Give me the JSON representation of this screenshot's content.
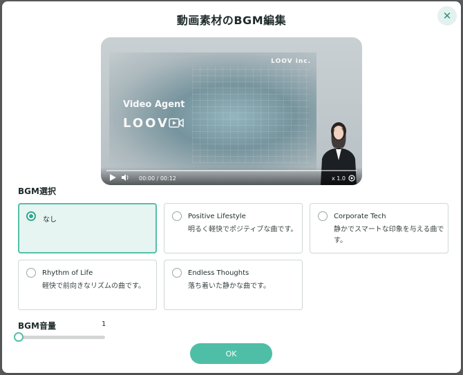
{
  "modal": {
    "title": "動画素材のBGM編集",
    "close_glyph": "✕"
  },
  "player": {
    "slide_brand": "LOOV inc.",
    "slide_heading": "Video Agent",
    "slide_logo": "LOOV",
    "time": "00:00 / 00:12",
    "speed": "x 1.0"
  },
  "bgm": {
    "section_label": "BGM選択",
    "options": [
      {
        "title": "なし",
        "desc": "",
        "selected": true
      },
      {
        "title": "Positive Lifestyle",
        "desc": "明るく軽快でポジティブな曲です。",
        "selected": false
      },
      {
        "title": "Corporate Tech",
        "desc": "静かでスマートな印象を与える曲です。",
        "selected": false
      },
      {
        "title": "Rhythm of Life",
        "desc": "軽快で前向きなリズムの曲です。",
        "selected": false
      },
      {
        "title": "Endless Thoughts",
        "desc": "落ち着いた静かな曲です。",
        "selected": false
      }
    ]
  },
  "volume": {
    "label": "BGM音量",
    "value": "1"
  },
  "ok_label": "OK",
  "colors": {
    "accent": "#4fbea6",
    "accent_light": "#e6f5f1"
  }
}
